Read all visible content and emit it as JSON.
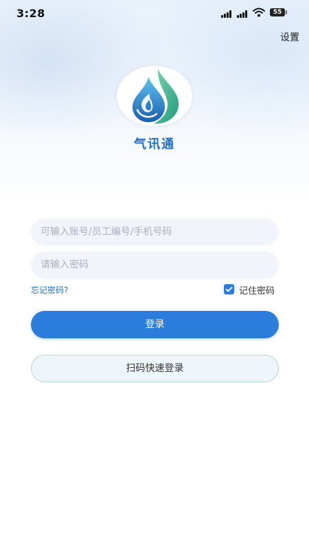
{
  "status_bar": {
    "time": "3:28",
    "battery": "55"
  },
  "header": {
    "settings_label": "设置"
  },
  "app": {
    "name": "气讯通",
    "logo_icon": "water-drop-logo-icon"
  },
  "login": {
    "account_placeholder": "可输入账号/员工编号/手机号码",
    "password_placeholder": "请输入密码",
    "forgot_label": "忘记密码?",
    "remember_label": "记住密码",
    "remember_checked": true,
    "login_label": "登录",
    "qr_login_label": "扫码快速登录"
  },
  "colors": {
    "accent": "#2c7ddb",
    "link": "#1f6fc4",
    "input_bg": "#f2f4fc",
    "qr_bg": "#eef5fb",
    "qr_border": "#b9d3df"
  }
}
